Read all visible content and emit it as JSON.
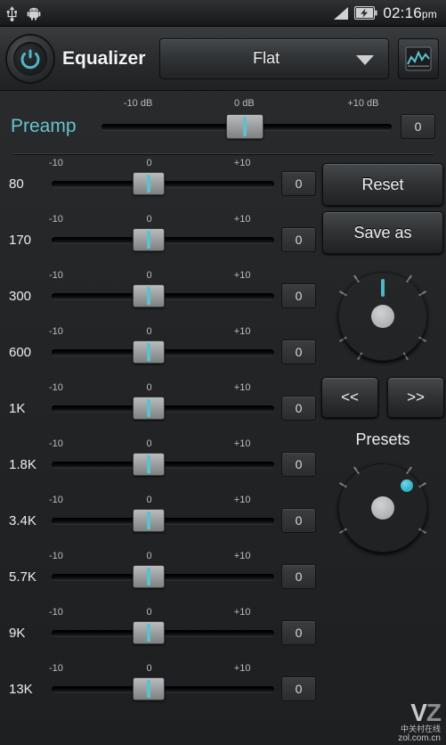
{
  "statusbar": {
    "icons": [
      "usb-icon",
      "android-icon",
      "signal-icon",
      "battery-charging-icon"
    ],
    "time": "02:16",
    "ampm": "pm"
  },
  "titlebar": {
    "power_button": "power-icon",
    "title": "Equalizer",
    "preset_selected": "Flat",
    "eq_icon": "equalizer-icon"
  },
  "preamp": {
    "label": "Preamp",
    "scale": [
      "-10 dB",
      "0 dB",
      "+10 dB"
    ],
    "value": "0"
  },
  "band_scale": [
    "-10",
    "0",
    "+10"
  ],
  "bands": [
    {
      "freq": "80",
      "value": "0"
    },
    {
      "freq": "170",
      "value": "0"
    },
    {
      "freq": "300",
      "value": "0"
    },
    {
      "freq": "600",
      "value": "0"
    },
    {
      "freq": "1K",
      "value": "0"
    },
    {
      "freq": "1.8K",
      "value": "0"
    },
    {
      "freq": "3.4K",
      "value": "0"
    },
    {
      "freq": "5.7K",
      "value": "0"
    },
    {
      "freq": "9K",
      "value": "0"
    },
    {
      "freq": "13K",
      "value": "0"
    }
  ],
  "controls": {
    "reset": "Reset",
    "save_as": "Save as",
    "prev": "<<",
    "next": ">>",
    "presets_label": "Presets"
  },
  "watermark": {
    "logo": "VZ",
    "line1": "中关村在线",
    "line2": "zol.com.cn"
  },
  "colors": {
    "accent": "#5fc0cc",
    "preamp_label": "#67c4cf",
    "panel": "#232527",
    "text": "#ededed"
  }
}
